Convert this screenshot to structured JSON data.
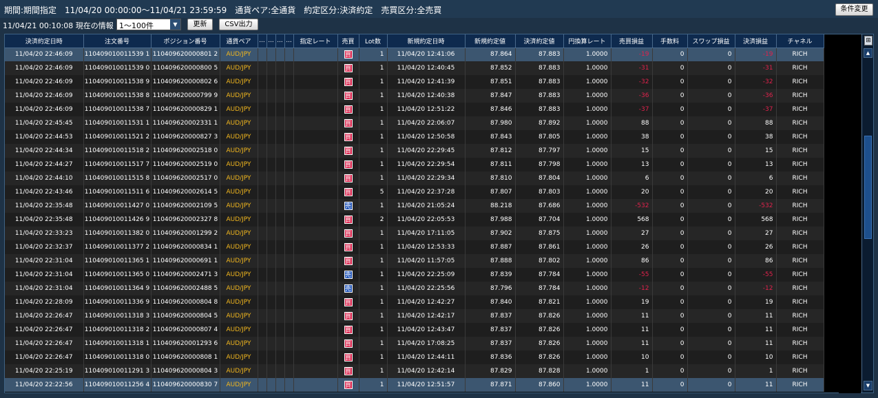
{
  "header": {
    "condition_text": "期間:期間指定　11/04/20 00:00:00～11/04/21 23:59:59　通貨ペア:全通貨　約定区分:決済約定　売買区分:全売買",
    "change_button": "条件変更",
    "info_text": "11/04/21 00:10:08 現在の情報",
    "range_value": "1～100件",
    "update_button": "更新",
    "csv_button": "CSV出力"
  },
  "table": {
    "columns": [
      "決済約定日時",
      "注文番号",
      "ポジション番号",
      "通貨ペア",
      "...",
      "...",
      "...",
      "...",
      "指定レート",
      "売買",
      "Lot数",
      "新規約定日時",
      "新規約定値",
      "決済約定値",
      "円換算レート",
      "売買損益",
      "手数料",
      "スワップ損益",
      "決済損益",
      "チャネル"
    ],
    "rows": [
      {
        "dt": "11/04/20 22:46:09",
        "order": "110409010011539 1",
        "pos": "110409620000801 2",
        "pair": "AUD/JPY",
        "side": "買",
        "lot": "1",
        "open_dt": "11/04/20 12:41:06",
        "open": "87.864",
        "close": "87.883",
        "rate": "1.0000",
        "pl": "-19",
        "fee": "0",
        "swap": "0",
        "net": "-19",
        "ch": "RICH"
      },
      {
        "dt": "11/04/20 22:46:09",
        "order": "110409010011539 0",
        "pos": "110409620000800 5",
        "pair": "AUD/JPY",
        "side": "買",
        "lot": "1",
        "open_dt": "11/04/20 12:40:45",
        "open": "87.852",
        "close": "87.883",
        "rate": "1.0000",
        "pl": "-31",
        "fee": "0",
        "swap": "0",
        "net": "-31",
        "ch": "RICH"
      },
      {
        "dt": "11/04/20 22:46:09",
        "order": "110409010011538 9",
        "pos": "110409620000802 6",
        "pair": "AUD/JPY",
        "side": "買",
        "lot": "1",
        "open_dt": "11/04/20 12:41:39",
        "open": "87.851",
        "close": "87.883",
        "rate": "1.0000",
        "pl": "-32",
        "fee": "0",
        "swap": "0",
        "net": "-32",
        "ch": "RICH"
      },
      {
        "dt": "11/04/20 22:46:09",
        "order": "110409010011538 8",
        "pos": "110409620000799 9",
        "pair": "AUD/JPY",
        "side": "買",
        "lot": "1",
        "open_dt": "11/04/20 12:40:38",
        "open": "87.847",
        "close": "87.883",
        "rate": "1.0000",
        "pl": "-36",
        "fee": "0",
        "swap": "0",
        "net": "-36",
        "ch": "RICH"
      },
      {
        "dt": "11/04/20 22:46:09",
        "order": "110409010011538 7",
        "pos": "110409620000829 1",
        "pair": "AUD/JPY",
        "side": "買",
        "lot": "1",
        "open_dt": "11/04/20 12:51:22",
        "open": "87.846",
        "close": "87.883",
        "rate": "1.0000",
        "pl": "-37",
        "fee": "0",
        "swap": "0",
        "net": "-37",
        "ch": "RICH"
      },
      {
        "dt": "11/04/20 22:45:45",
        "order": "110409010011531 1",
        "pos": "110409620002331 1",
        "pair": "AUD/JPY",
        "side": "買",
        "lot": "1",
        "open_dt": "11/04/20 22:06:07",
        "open": "87.980",
        "close": "87.892",
        "rate": "1.0000",
        "pl": "88",
        "fee": "0",
        "swap": "0",
        "net": "88",
        "ch": "RICH"
      },
      {
        "dt": "11/04/20 22:44:53",
        "order": "110409010011521 2",
        "pos": "110409620000827 3",
        "pair": "AUD/JPY",
        "side": "買",
        "lot": "1",
        "open_dt": "11/04/20 12:50:58",
        "open": "87.843",
        "close": "87.805",
        "rate": "1.0000",
        "pl": "38",
        "fee": "0",
        "swap": "0",
        "net": "38",
        "ch": "RICH"
      },
      {
        "dt": "11/04/20 22:44:34",
        "order": "110409010011518 2",
        "pos": "110409620002518 0",
        "pair": "AUD/JPY",
        "side": "買",
        "lot": "1",
        "open_dt": "11/04/20 22:29:45",
        "open": "87.812",
        "close": "87.797",
        "rate": "1.0000",
        "pl": "15",
        "fee": "0",
        "swap": "0",
        "net": "15",
        "ch": "RICH"
      },
      {
        "dt": "11/04/20 22:44:27",
        "order": "110409010011517 7",
        "pos": "110409620002519 0",
        "pair": "AUD/JPY",
        "side": "買",
        "lot": "1",
        "open_dt": "11/04/20 22:29:54",
        "open": "87.811",
        "close": "87.798",
        "rate": "1.0000",
        "pl": "13",
        "fee": "0",
        "swap": "0",
        "net": "13",
        "ch": "RICH"
      },
      {
        "dt": "11/04/20 22:44:10",
        "order": "110409010011515 8",
        "pos": "110409620002517 0",
        "pair": "AUD/JPY",
        "side": "買",
        "lot": "1",
        "open_dt": "11/04/20 22:29:34",
        "open": "87.810",
        "close": "87.804",
        "rate": "1.0000",
        "pl": "6",
        "fee": "0",
        "swap": "0",
        "net": "6",
        "ch": "RICH"
      },
      {
        "dt": "11/04/20 22:43:46",
        "order": "110409010011511 6",
        "pos": "110409620002614 5",
        "pair": "AUD/JPY",
        "side": "買",
        "lot": "5",
        "open_dt": "11/04/20 22:37:28",
        "open": "87.807",
        "close": "87.803",
        "rate": "1.0000",
        "pl": "20",
        "fee": "0",
        "swap": "0",
        "net": "20",
        "ch": "RICH"
      },
      {
        "dt": "11/04/20 22:35:48",
        "order": "110409010011427 0",
        "pos": "110409620002109 5",
        "pair": "AUD/JPY",
        "side": "売",
        "lot": "1",
        "open_dt": "11/04/20 21:05:24",
        "open": "88.218",
        "close": "87.686",
        "rate": "1.0000",
        "pl": "-532",
        "fee": "0",
        "swap": "0",
        "net": "-532",
        "ch": "RICH"
      },
      {
        "dt": "11/04/20 22:35:48",
        "order": "110409010011426 9",
        "pos": "110409620002327 8",
        "pair": "AUD/JPY",
        "side": "買",
        "lot": "2",
        "open_dt": "11/04/20 22:05:53",
        "open": "87.988",
        "close": "87.704",
        "rate": "1.0000",
        "pl": "568",
        "fee": "0",
        "swap": "0",
        "net": "568",
        "ch": "RICH"
      },
      {
        "dt": "11/04/20 22:33:23",
        "order": "110409010011382 0",
        "pos": "110409620001299 2",
        "pair": "AUD/JPY",
        "side": "買",
        "lot": "1",
        "open_dt": "11/04/20 17:11:05",
        "open": "87.902",
        "close": "87.875",
        "rate": "1.0000",
        "pl": "27",
        "fee": "0",
        "swap": "0",
        "net": "27",
        "ch": "RICH"
      },
      {
        "dt": "11/04/20 22:32:37",
        "order": "110409010011377 2",
        "pos": "110409620000834 1",
        "pair": "AUD/JPY",
        "side": "買",
        "lot": "1",
        "open_dt": "11/04/20 12:53:33",
        "open": "87.887",
        "close": "87.861",
        "rate": "1.0000",
        "pl": "26",
        "fee": "0",
        "swap": "0",
        "net": "26",
        "ch": "RICH"
      },
      {
        "dt": "11/04/20 22:31:04",
        "order": "110409010011365 1",
        "pos": "110409620000691 1",
        "pair": "AUD/JPY",
        "side": "買",
        "lot": "1",
        "open_dt": "11/04/20 11:57:05",
        "open": "87.888",
        "close": "87.802",
        "rate": "1.0000",
        "pl": "86",
        "fee": "0",
        "swap": "0",
        "net": "86",
        "ch": "RICH"
      },
      {
        "dt": "11/04/20 22:31:04",
        "order": "110409010011365 0",
        "pos": "110409620002471 3",
        "pair": "AUD/JPY",
        "side": "売",
        "lot": "1",
        "open_dt": "11/04/20 22:25:09",
        "open": "87.839",
        "close": "87.784",
        "rate": "1.0000",
        "pl": "-55",
        "fee": "0",
        "swap": "0",
        "net": "-55",
        "ch": "RICH"
      },
      {
        "dt": "11/04/20 22:31:04",
        "order": "110409010011364 9",
        "pos": "110409620002488 5",
        "pair": "AUD/JPY",
        "side": "売",
        "lot": "1",
        "open_dt": "11/04/20 22:25:56",
        "open": "87.796",
        "close": "87.784",
        "rate": "1.0000",
        "pl": "-12",
        "fee": "0",
        "swap": "0",
        "net": "-12",
        "ch": "RICH"
      },
      {
        "dt": "11/04/20 22:28:09",
        "order": "110409010011336 9",
        "pos": "110409620000804 8",
        "pair": "AUD/JPY",
        "side": "買",
        "lot": "1",
        "open_dt": "11/04/20 12:42:27",
        "open": "87.840",
        "close": "87.821",
        "rate": "1.0000",
        "pl": "19",
        "fee": "0",
        "swap": "0",
        "net": "19",
        "ch": "RICH"
      },
      {
        "dt": "11/04/20 22:26:47",
        "order": "110409010011318 3",
        "pos": "110409620000804 5",
        "pair": "AUD/JPY",
        "side": "買",
        "lot": "1",
        "open_dt": "11/04/20 12:42:17",
        "open": "87.837",
        "close": "87.826",
        "rate": "1.0000",
        "pl": "11",
        "fee": "0",
        "swap": "0",
        "net": "11",
        "ch": "RICH"
      },
      {
        "dt": "11/04/20 22:26:47",
        "order": "110409010011318 2",
        "pos": "110409620000807 4",
        "pair": "AUD/JPY",
        "side": "買",
        "lot": "1",
        "open_dt": "11/04/20 12:43:47",
        "open": "87.837",
        "close": "87.826",
        "rate": "1.0000",
        "pl": "11",
        "fee": "0",
        "swap": "0",
        "net": "11",
        "ch": "RICH"
      },
      {
        "dt": "11/04/20 22:26:47",
        "order": "110409010011318 1",
        "pos": "110409620001293 6",
        "pair": "AUD/JPY",
        "side": "買",
        "lot": "1",
        "open_dt": "11/04/20 17:08:25",
        "open": "87.837",
        "close": "87.826",
        "rate": "1.0000",
        "pl": "11",
        "fee": "0",
        "swap": "0",
        "net": "11",
        "ch": "RICH"
      },
      {
        "dt": "11/04/20 22:26:47",
        "order": "110409010011318 0",
        "pos": "110409620000808 1",
        "pair": "AUD/JPY",
        "side": "買",
        "lot": "1",
        "open_dt": "11/04/20 12:44:11",
        "open": "87.836",
        "close": "87.826",
        "rate": "1.0000",
        "pl": "10",
        "fee": "0",
        "swap": "0",
        "net": "10",
        "ch": "RICH"
      },
      {
        "dt": "11/04/20 22:25:19",
        "order": "110409010011291 3",
        "pos": "110409620000804 3",
        "pair": "AUD/JPY",
        "side": "買",
        "lot": "1",
        "open_dt": "11/04/20 12:42:14",
        "open": "87.829",
        "close": "87.828",
        "rate": "1.0000",
        "pl": "1",
        "fee": "0",
        "swap": "0",
        "net": "1",
        "ch": "RICH"
      },
      {
        "dt": "11/04/20 22:22:56",
        "order": "110409010011256 4",
        "pos": "110409620000830 7",
        "pair": "AUD/JPY",
        "side": "買",
        "lot": "1",
        "open_dt": "11/04/20 12:51:57",
        "open": "87.871",
        "close": "87.860",
        "rate": "1.0000",
        "pl": "11",
        "fee": "0",
        "swap": "0",
        "net": "11",
        "ch": "RICH"
      }
    ]
  },
  "icons": {
    "select_arrow": "chevron-down-icon",
    "column_chooser": "column-chooser-icon",
    "scroll_up": "arrow-up-icon",
    "scroll_down": "arrow-down-icon"
  },
  "colors": {
    "header_bg": "#213a52",
    "grid_bg": "#000000",
    "column_header_bg": "#0e2a4e",
    "pair_text": "#f2b71e",
    "loss_text": "#e0224c",
    "buy_badge": "#d8204a",
    "sell_badge": "#2054b8",
    "selected_row": "#3c5670"
  }
}
